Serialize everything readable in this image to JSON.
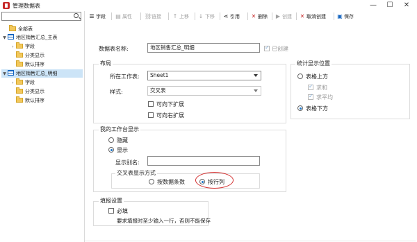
{
  "window": {
    "title": "管理数据表",
    "minimize": "—",
    "maximize": "☐",
    "close": "✕"
  },
  "sidebar": {
    "search_placeholder": "",
    "tree": [
      {
        "label": "全部表",
        "type": "folder",
        "level": 0
      },
      {
        "label": "地区销售汇总_主表",
        "type": "table",
        "level": 0,
        "expanded": true
      },
      {
        "label": "字段",
        "type": "folder",
        "level": 1
      },
      {
        "label": "分类显示",
        "type": "folder",
        "level": 1
      },
      {
        "label": "默认排序",
        "type": "folder",
        "level": 1
      },
      {
        "label": "地区销售汇总_明细",
        "type": "table",
        "level": 0,
        "expanded": true,
        "selected": true
      },
      {
        "label": "字段",
        "type": "folder",
        "level": 1
      },
      {
        "label": "分类显示",
        "type": "folder",
        "level": 1
      },
      {
        "label": "默认排序",
        "type": "folder",
        "level": 1
      }
    ]
  },
  "toolbar": {
    "fields": "字段",
    "properties": "属性",
    "link": "链接",
    "move_up": "上移",
    "move_down": "下移",
    "reference": "引用",
    "delete": "删除",
    "create": "创建",
    "cancel_create": "取消创建",
    "save": "保存"
  },
  "form": {
    "table_name_label": "数据表名称:",
    "table_name_value": "地区销售汇总_明细",
    "created_label": "已创建",
    "created_checked": true,
    "layout": {
      "title": "布局",
      "sheet_label": "所在工作表:",
      "sheet_value": "Sheet1",
      "style_label": "样式:",
      "style_value": "交叉表",
      "expand_down_label": "可向下扩展",
      "expand_right_label": "可向右扩展"
    },
    "stats": {
      "title": "统计显示位置",
      "above_label": "表格上方",
      "sum_label": "求和",
      "avg_label": "求平均",
      "below_label": "表格下方",
      "selected": "below"
    },
    "workbench": {
      "title": "我的工作台显示",
      "hide_label": "隐藏",
      "show_label": "显示",
      "selected": "show",
      "alias_label": "显示别名:",
      "alias_value": "",
      "crosstab_title": "交叉表显示方式",
      "by_record_label": "按数据条数",
      "by_row_col_label": "按行列",
      "crosstab_selected": "by_row_col"
    },
    "fill": {
      "title": "填报设置",
      "required_label": "必填",
      "note": "要求填报时至少输入一行，否则不能保存"
    }
  },
  "colors": {
    "accent": "#1a73c6",
    "highlight_ellipse": "#d32f2f",
    "selected_row": "#cce4f7"
  }
}
